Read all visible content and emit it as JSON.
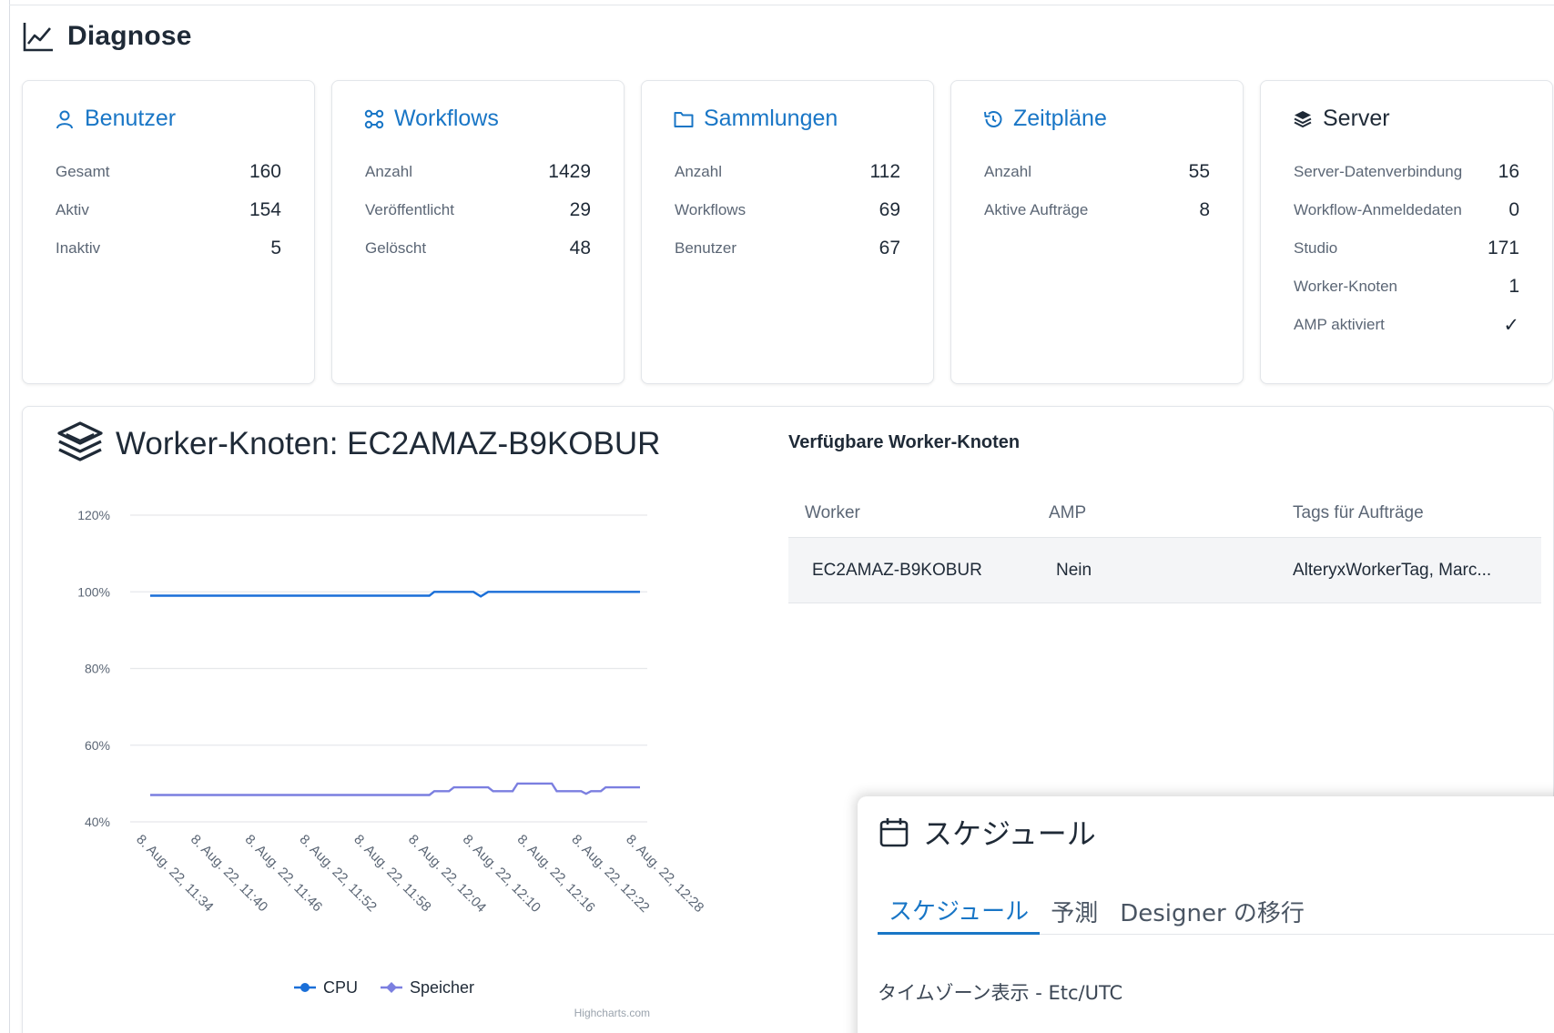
{
  "page": {
    "title": "Diagnose"
  },
  "cards": {
    "users": {
      "title": "Benutzer",
      "rows": [
        {
          "label": "Gesamt",
          "value": "160"
        },
        {
          "label": "Aktiv",
          "value": "154"
        },
        {
          "label": "Inaktiv",
          "value": "5"
        }
      ]
    },
    "workflows": {
      "title": "Workflows",
      "rows": [
        {
          "label": "Anzahl",
          "value": "1429"
        },
        {
          "label": "Veröffentlicht",
          "value": "29"
        },
        {
          "label": "Gelöscht",
          "value": "48"
        }
      ]
    },
    "collections": {
      "title": "Sammlungen",
      "rows": [
        {
          "label": "Anzahl",
          "value": "112"
        },
        {
          "label": "Workflows",
          "value": "69"
        },
        {
          "label": "Benutzer",
          "value": "67"
        }
      ]
    },
    "schedules": {
      "title": "Zeitpläne",
      "rows": [
        {
          "label": "Anzahl",
          "value": "55"
        },
        {
          "label": "Aktive Aufträge",
          "value": "8"
        }
      ]
    },
    "server": {
      "title": "Server",
      "rows": [
        {
          "label": "Server-Datenverbindung",
          "value": "16"
        },
        {
          "label": "Workflow-Anmeldedaten",
          "value": "0"
        },
        {
          "label": "Studio",
          "value": "171"
        },
        {
          "label": "Worker-Knoten",
          "value": "1"
        },
        {
          "label": "AMP aktiviert",
          "value": "✓"
        }
      ]
    }
  },
  "worker": {
    "title": "Worker-Knoten: EC2AMAZ-B9KOBUR",
    "available_title": "Verfügbare Worker-Knoten",
    "table": {
      "headers": [
        "Worker",
        "AMP",
        "Tags für Aufträge"
      ],
      "rows": [
        [
          "EC2AMAZ-B9KOBUR",
          "Nein",
          "AlteryxWorkerTag, Marc..."
        ]
      ]
    },
    "credits": "Highcharts.com"
  },
  "chart_data": {
    "type": "line",
    "x": [
      "8. Aug. 22, 11:34",
      "8. Aug. 22, 11:40",
      "8. Aug. 22, 11:46",
      "8. Aug. 22, 11:52",
      "8. Aug. 22, 11:58",
      "8. Aug. 22, 12:04",
      "8. Aug. 22, 12:10",
      "8. Aug. 22, 12:16",
      "8. Aug. 22, 12:22",
      "8. Aug. 22, 12:28"
    ],
    "yticks": [
      "120%",
      "100%",
      "80%",
      "60%",
      "40%"
    ],
    "ylim": [
      40,
      120
    ],
    "series": [
      {
        "name": "CPU",
        "color": "#1a6fd8",
        "points": [
          [
            0,
            99
          ],
          [
            1,
            99
          ],
          [
            2,
            99
          ],
          [
            3,
            99
          ],
          [
            4,
            99
          ],
          [
            5,
            99
          ],
          [
            5.7,
            99
          ],
          [
            5.8,
            100
          ],
          [
            6.6,
            100
          ],
          [
            6.75,
            98.8
          ],
          [
            6.9,
            100
          ],
          [
            7.5,
            100
          ],
          [
            8.5,
            100
          ],
          [
            9.0,
            100
          ],
          [
            10,
            100
          ]
        ]
      },
      {
        "name": "Speicher",
        "color": "#7b7fe0",
        "points": [
          [
            0,
            47
          ],
          [
            1,
            47
          ],
          [
            2,
            47
          ],
          [
            3,
            47
          ],
          [
            4,
            47
          ],
          [
            5,
            47
          ],
          [
            5.7,
            47
          ],
          [
            5.8,
            48
          ],
          [
            6.1,
            48
          ],
          [
            6.2,
            49
          ],
          [
            6.9,
            49
          ],
          [
            7.0,
            48
          ],
          [
            7.4,
            48
          ],
          [
            7.5,
            50
          ],
          [
            8.2,
            50
          ],
          [
            8.3,
            48
          ],
          [
            8.8,
            48
          ],
          [
            8.9,
            47.3
          ],
          [
            9.0,
            48
          ],
          [
            9.2,
            48
          ],
          [
            9.3,
            49
          ],
          [
            10,
            49
          ]
        ]
      }
    ],
    "grid": true,
    "legend": "bottom-center"
  },
  "schedule_panel": {
    "title": "スケジュール",
    "tabs": [
      "スケジュール",
      "予測",
      "Designer の移行"
    ],
    "timezone": "タイムゾーン表示 - Etc/UTC"
  },
  "colors": {
    "accent": "#1976c6",
    "cpu": "#1a6fd8",
    "memory": "#7b7fe0"
  }
}
